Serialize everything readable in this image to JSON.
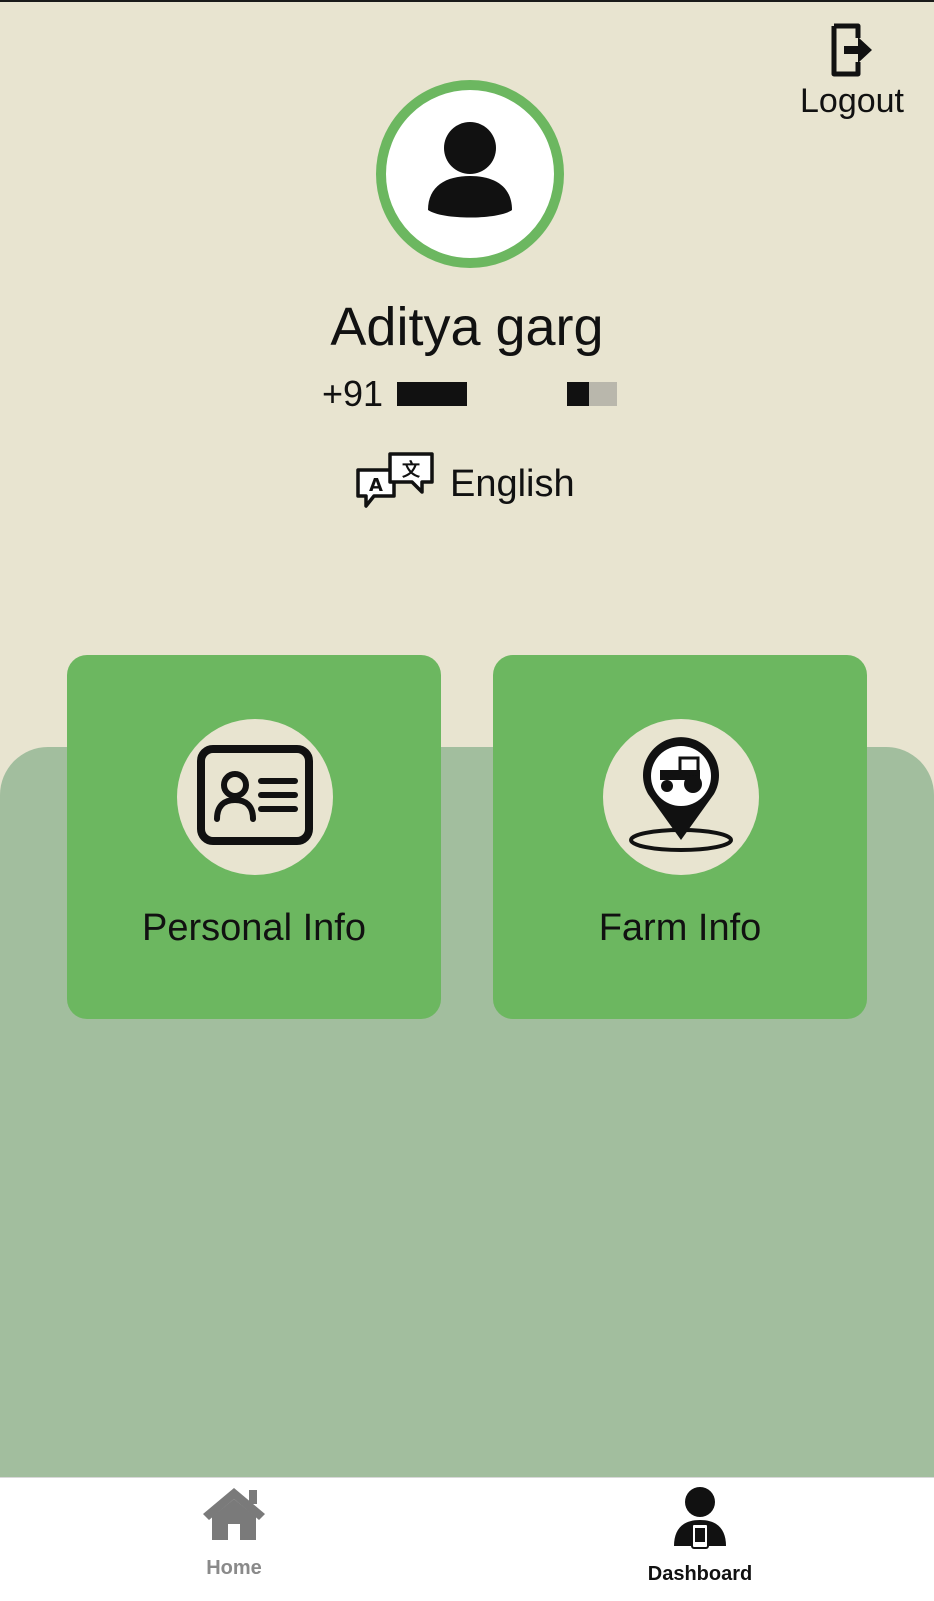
{
  "header": {
    "logout_label": "Logout",
    "logout_icon": "logout-icon"
  },
  "profile": {
    "avatar_icon": "user-icon",
    "name": "Aditya garg",
    "phone_prefix": "+91",
    "language_label": "English",
    "language_icon": "translate-icon"
  },
  "cards": {
    "personal_label": "Personal Info",
    "personal_icon": "id-card-icon",
    "farm_label": "Farm Info",
    "farm_icon": "tractor-location-icon"
  },
  "bottom_nav": {
    "home_label": "Home",
    "home_icon": "home-icon",
    "dashboard_label": "Dashboard",
    "dashboard_icon": "user-phone-icon",
    "active": "Dashboard"
  },
  "colors": {
    "background": "#e8e4d0",
    "accent_green": "#6cb760",
    "panel_green": "#a2be9e",
    "nav_background": "#ffffff"
  }
}
